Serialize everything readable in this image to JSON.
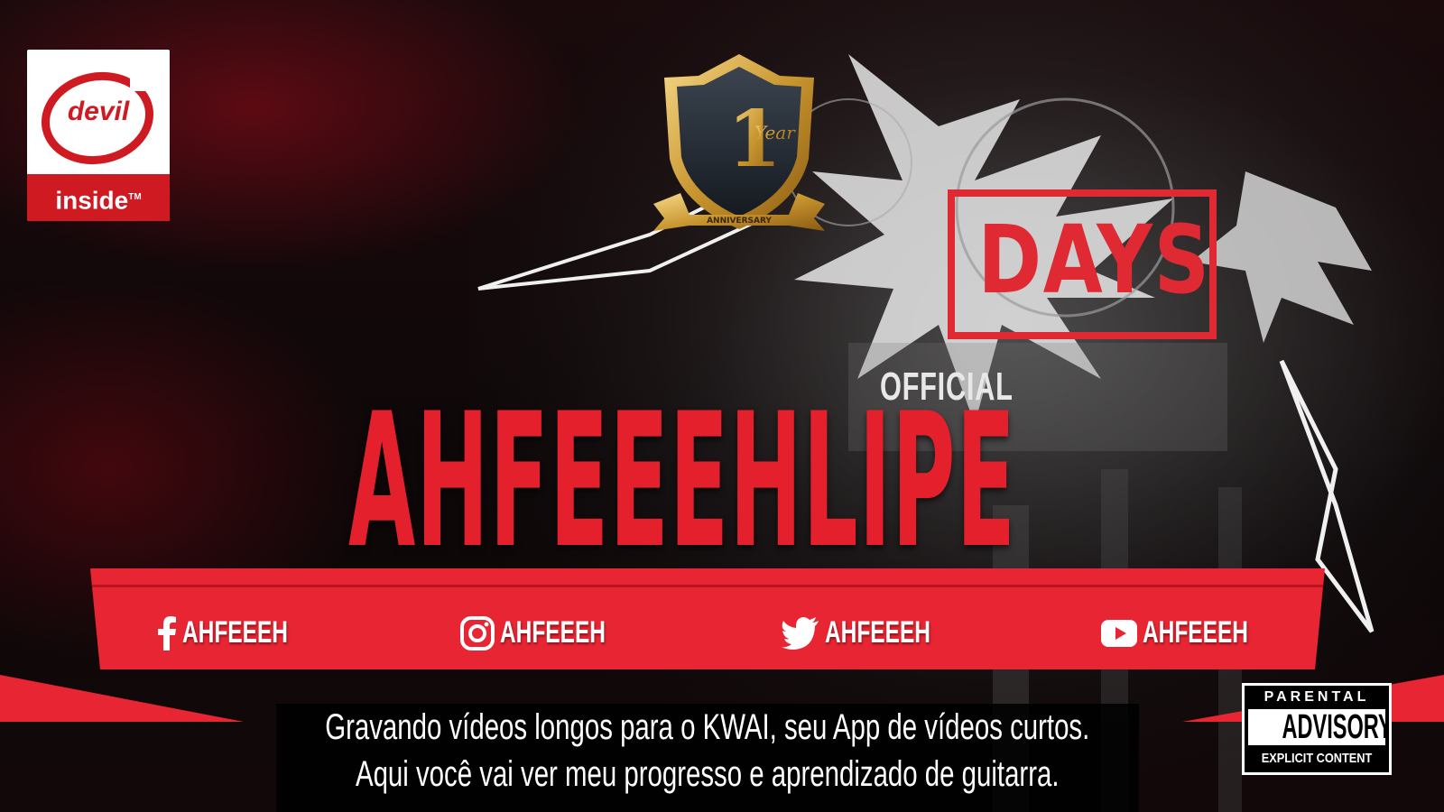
{
  "logo": {
    "brand": "devil",
    "tagline": "inside",
    "mark": "TM"
  },
  "badge": {
    "number": "1",
    "unit": "Year",
    "ribbon": "ANNIVERSARY"
  },
  "stamp": {
    "text": "DAYS"
  },
  "header": {
    "official": "OFFICIAL",
    "title": "AHFEEEHLIPE"
  },
  "socials": [
    {
      "network": "facebook",
      "icon": "facebook-icon",
      "handle": "AHFEEEH"
    },
    {
      "network": "instagram",
      "icon": "instagram-icon",
      "handle": "AHFEEEH"
    },
    {
      "network": "twitter",
      "icon": "twitter-icon",
      "handle": "AHFEEEH"
    },
    {
      "network": "youtube",
      "icon": "youtube-icon",
      "handle": "AHFEEEH"
    }
  ],
  "description": [
    "Gravando vídeos longos para o KWAI, seu App de vídeos curtos.",
    "Aqui você vai ver meu progresso e aprendizado de guitarra."
  ],
  "advisory": {
    "top": "PARENTAL",
    "middle": "ADVISORY",
    "bottom": "EXPLICIT CONTENT"
  },
  "colors": {
    "accent": "#e82532",
    "title": "#e3202b",
    "background": "#0b0607"
  }
}
